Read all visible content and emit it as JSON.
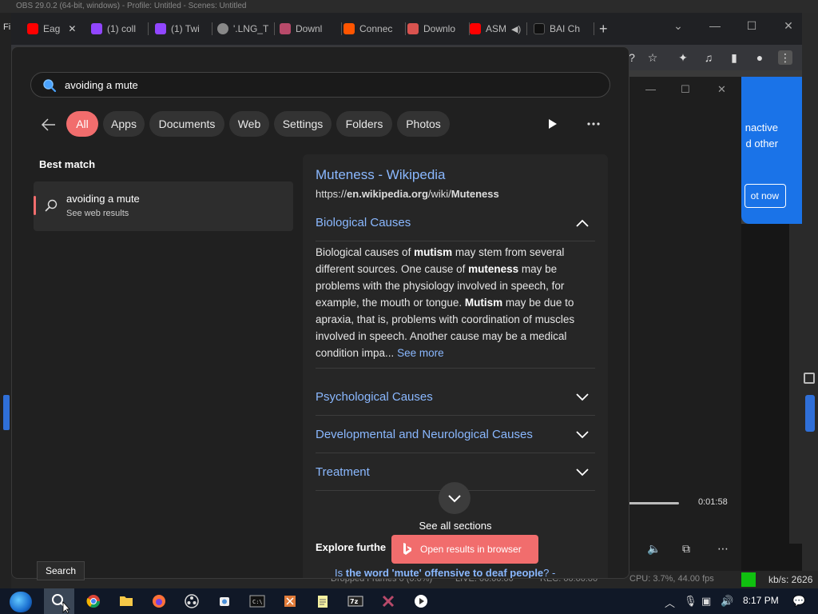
{
  "obs_title": "OBS 29.0.2 (64-bit, windows) - Profile: Untitled - Scenes: Untitled",
  "left_strip_label": "Fi",
  "chrome": {
    "tabs": [
      {
        "label": "Eag",
        "fav_color": "#ff0000"
      },
      {
        "label": "(1) coll",
        "fav_color": "#9146ff"
      },
      {
        "label": "(1) Twi",
        "fav_color": "#9146ff"
      },
      {
        "label": "'.LNG_T",
        "fav_color": "#888888"
      },
      {
        "label": "Downl",
        "fav_color": "#b84a6a"
      },
      {
        "label": "Connec",
        "fav_color": "#ff5500"
      },
      {
        "label": "Downlo",
        "fav_color": "#d9534f"
      },
      {
        "label": "ASM",
        "fav_color": "#ff0000"
      },
      {
        "label": "BAI Ch",
        "fav_color": "#111111"
      }
    ],
    "new_tab": "+"
  },
  "popup": {
    "time": "0:01:58",
    "blue_card_text": "nactive\nd other",
    "not_now": "ot now"
  },
  "search": {
    "query": "avoiding a mute",
    "filters": [
      "All",
      "Apps",
      "Documents",
      "Web",
      "Settings",
      "Folders",
      "Photos"
    ],
    "best_match_label": "Best match",
    "result_title": "avoiding a mute",
    "result_subtitle": "See web results",
    "wiki_title": "Muteness - Wikipedia",
    "wiki_url_prefix": "https://",
    "wiki_url_domain": "en.wikipedia.org",
    "wiki_url_path": "/wiki/",
    "wiki_url_page": "Muteness",
    "sections": [
      {
        "label": "Biological Causes",
        "expanded": true
      },
      {
        "label": "Psychological Causes",
        "expanded": false
      },
      {
        "label": "Developmental and Neurological Causes",
        "expanded": false
      },
      {
        "label": "Treatment",
        "expanded": false
      }
    ],
    "bio_text": {
      "p1": "Biological causes of ",
      "b1": "mutism",
      "p2": " may stem from several different sources. One cause of ",
      "b2": "muteness",
      "p3": " may be problems with the physiology involved in speech, for example, the mouth or tongue. ",
      "b3": "Mutism",
      "p4": " may be due to apraxia, that is, problems with coordination of muscles involved in speech. Another cause may be a medical condition impa... ",
      "see_more": "See more"
    },
    "see_all_sections": "See all sections",
    "explore_further": "Explore furthe",
    "open_in_browser": "Open results in browser",
    "related_prefix": "Is ",
    "related_bold": "the word 'mute' offensive to deaf people",
    "related_suffix": "? -",
    "tooltip": "Search"
  },
  "obs_status": {
    "left": "Dropped Frames 0 (0.0%)",
    "mid": "LIVE: 00:00:00",
    "mid2": "REC: 00:00:00",
    "cpu": "CPU: 3.7%, 44.00 fps",
    "kbs": "kb/s: 2626"
  },
  "taskbar": {
    "clock": "8:17 PM"
  },
  "colors": {
    "accent": "#f16d6d",
    "link": "#8ab8ff",
    "panel_bg": "#202020"
  }
}
